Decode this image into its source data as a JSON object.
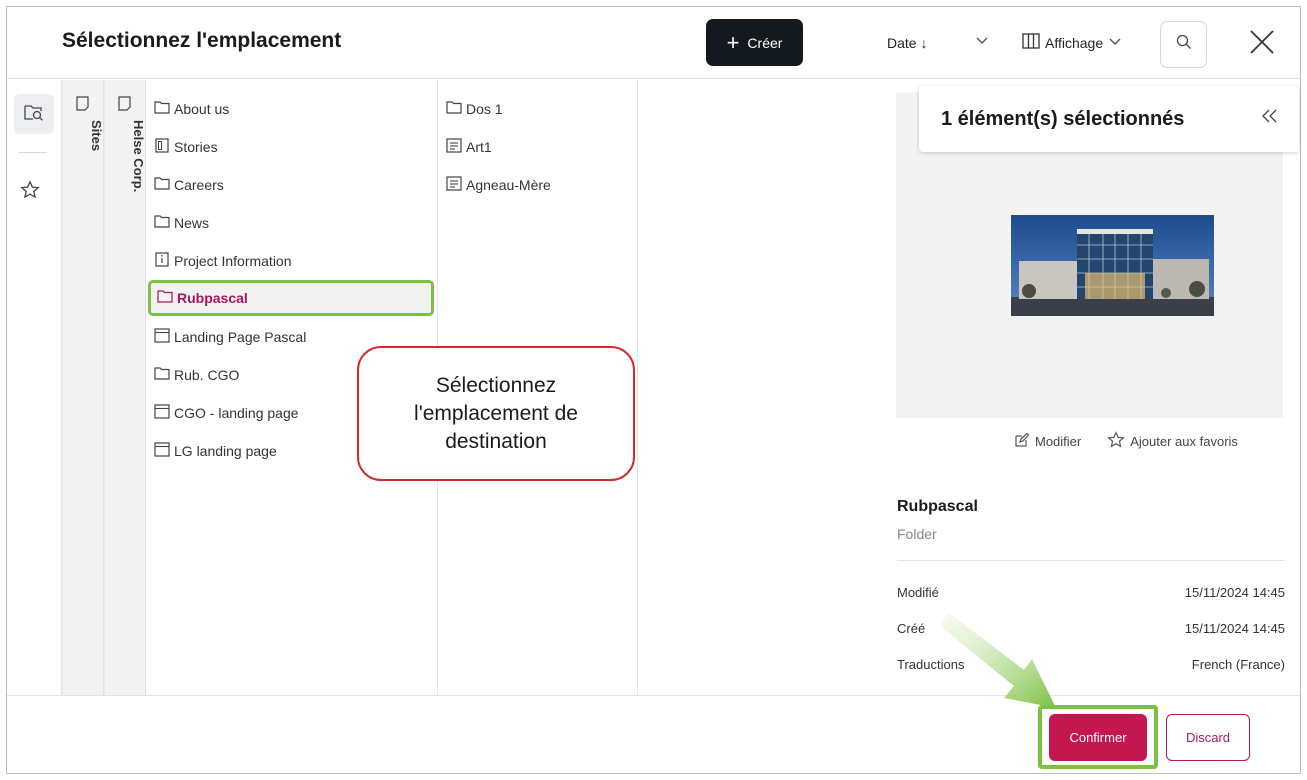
{
  "dialog": {
    "title": "Sélectionnez l'emplacement",
    "create_label": "Créer",
    "sort_label": "Date ↓",
    "view_label": "Affichage"
  },
  "rail": {
    "icons": [
      "folder-search-icon",
      "star-icon"
    ]
  },
  "breadcrumb_tabs": [
    {
      "label": "Sites"
    },
    {
      "label": "Helse Corp."
    }
  ],
  "columns": [
    {
      "items": [
        {
          "label": "About us",
          "icon": "folder-icon"
        },
        {
          "label": "Stories",
          "icon": "stories-icon"
        },
        {
          "label": "Careers",
          "icon": "folder-icon"
        },
        {
          "label": "News",
          "icon": "folder-icon"
        },
        {
          "label": "Project Information",
          "icon": "info-page-icon"
        },
        {
          "label": "Rubpascal",
          "icon": "folder-icon",
          "selected": true
        },
        {
          "label": "Landing Page Pascal",
          "icon": "landing-page-icon"
        },
        {
          "label": "Rub. CGO",
          "icon": "folder-icon"
        },
        {
          "label": "CGO - landing page",
          "icon": "landing-page-icon"
        },
        {
          "label": "LG landing page",
          "icon": "landing-page-icon"
        }
      ]
    },
    {
      "items": [
        {
          "label": "Dos 1",
          "icon": "folder-icon"
        },
        {
          "label": "Art1",
          "icon": "article-icon"
        },
        {
          "label": "Agneau-Mère",
          "icon": "article-icon"
        }
      ]
    }
  ],
  "callout": {
    "text": "Sélectionnez l'emplacement de destination"
  },
  "detail": {
    "selection_count": "1 élément(s) sélectionnés",
    "modify_label": "Modifier",
    "favorite_label": "Ajouter aux favoris",
    "name": "Rubpascal",
    "type": "Folder",
    "meta": [
      {
        "key": "Modifié",
        "value": "15/11/2024 14:45"
      },
      {
        "key": "Créé",
        "value": "15/11/2024 14:45"
      },
      {
        "key": "Traductions",
        "value": "French (France)"
      }
    ]
  },
  "footer": {
    "confirm_label": "Confirmer",
    "discard_label": "Discard"
  },
  "colors": {
    "accent": "#c5174f",
    "highlight": "#7dc142",
    "callout_border": "#d32c2c",
    "create_bg": "#14181f"
  }
}
